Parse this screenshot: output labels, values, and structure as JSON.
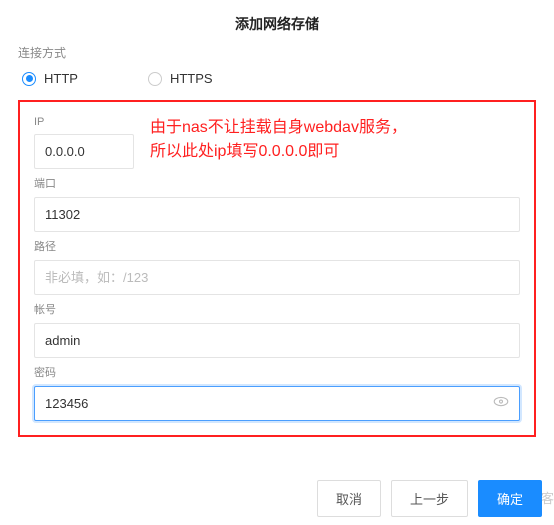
{
  "title": "添加网络存储",
  "connection": {
    "label": "连接方式",
    "options": {
      "http": "HTTP",
      "https": "HTTPS"
    },
    "selected": "http"
  },
  "fields": {
    "ip": {
      "label": "IP",
      "value": "0.0.0.0"
    },
    "port": {
      "label": "端口",
      "value": "11302"
    },
    "path": {
      "label": "路径",
      "placeholder": "非必填，如：/123"
    },
    "account": {
      "label": "帐号",
      "value": "admin"
    },
    "password": {
      "label": "密码",
      "value": "123456"
    }
  },
  "annotation": {
    "line1": "由于nas不让挂载自身webdav服务，",
    "line2": "所以此处ip填写0.0.0.0即可"
  },
  "buttons": {
    "cancel": "取消",
    "prev": "上一步",
    "ok": "确定"
  },
  "watermark": "客"
}
